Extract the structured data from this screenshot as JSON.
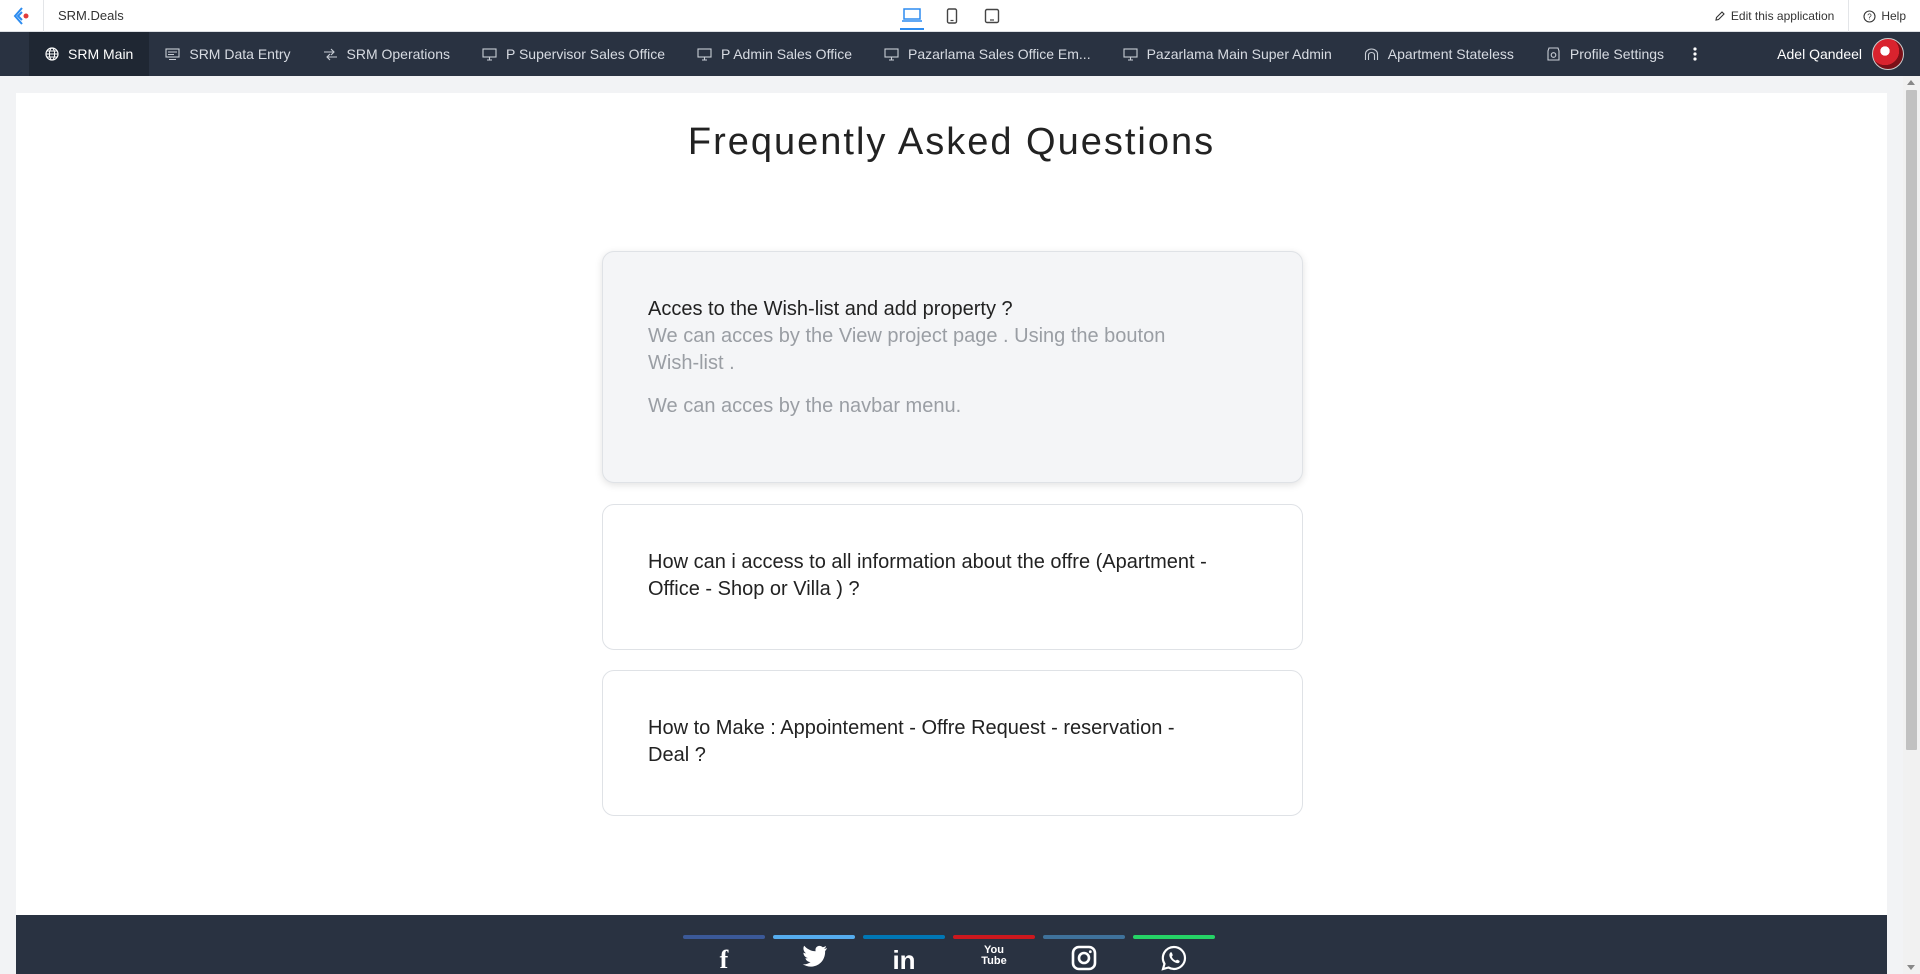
{
  "app": {
    "title": "SRM.Deals"
  },
  "topbar": {
    "edit_label": "Edit this application",
    "help_label": "Help"
  },
  "nav": {
    "items": [
      {
        "label": "SRM Main",
        "icon": "globe-icon",
        "active": true
      },
      {
        "label": "SRM Data Entry",
        "icon": "form-icon"
      },
      {
        "label": "SRM Operations",
        "icon": "operations-icon"
      },
      {
        "label": "P Supervisor Sales Office",
        "icon": "monitor-icon"
      },
      {
        "label": "P Admin Sales Office",
        "icon": "monitor-icon"
      },
      {
        "label": "Pazarlama Sales Office Em...",
        "icon": "monitor-icon"
      },
      {
        "label": "Pazarlama Main Super Admin",
        "icon": "monitor-icon"
      },
      {
        "label": "Apartment Stateless",
        "icon": "arch-icon"
      },
      {
        "label": "Profile Settings",
        "icon": "settings-icon"
      }
    ],
    "user_name": "Adel Qandeel"
  },
  "faq": {
    "title": "Frequently Asked Questions",
    "items": [
      {
        "question": "Acces to the Wish-list and add property ?",
        "answers": [
          "We can acces by the View project page . Using the bouton Wish-list .",
          "We can acces by the navbar menu."
        ],
        "open": true
      },
      {
        "question": "How can i access to all information about the offre (Apartment - Office - Shop or Villa ) ?",
        "open": false
      },
      {
        "question": "How to Make : Appointement - Offre Request - reservation - Deal ?",
        "open": false
      }
    ]
  },
  "footer": {
    "social": [
      {
        "name": "facebook-icon",
        "glyph": "f",
        "color": "#3b5998"
      },
      {
        "name": "twitter-icon",
        "glyph": "🐦",
        "color": "#55acee"
      },
      {
        "name": "linkedin-icon",
        "glyph": "in",
        "color": "#0077b5"
      },
      {
        "name": "youtube-icon",
        "glyph": "You Tube",
        "color": "#cc181e"
      },
      {
        "name": "instagram-icon",
        "glyph": "◎",
        "color": "#3f729b"
      },
      {
        "name": "whatsapp-icon",
        "glyph": "✆",
        "color": "#25d366"
      }
    ]
  }
}
